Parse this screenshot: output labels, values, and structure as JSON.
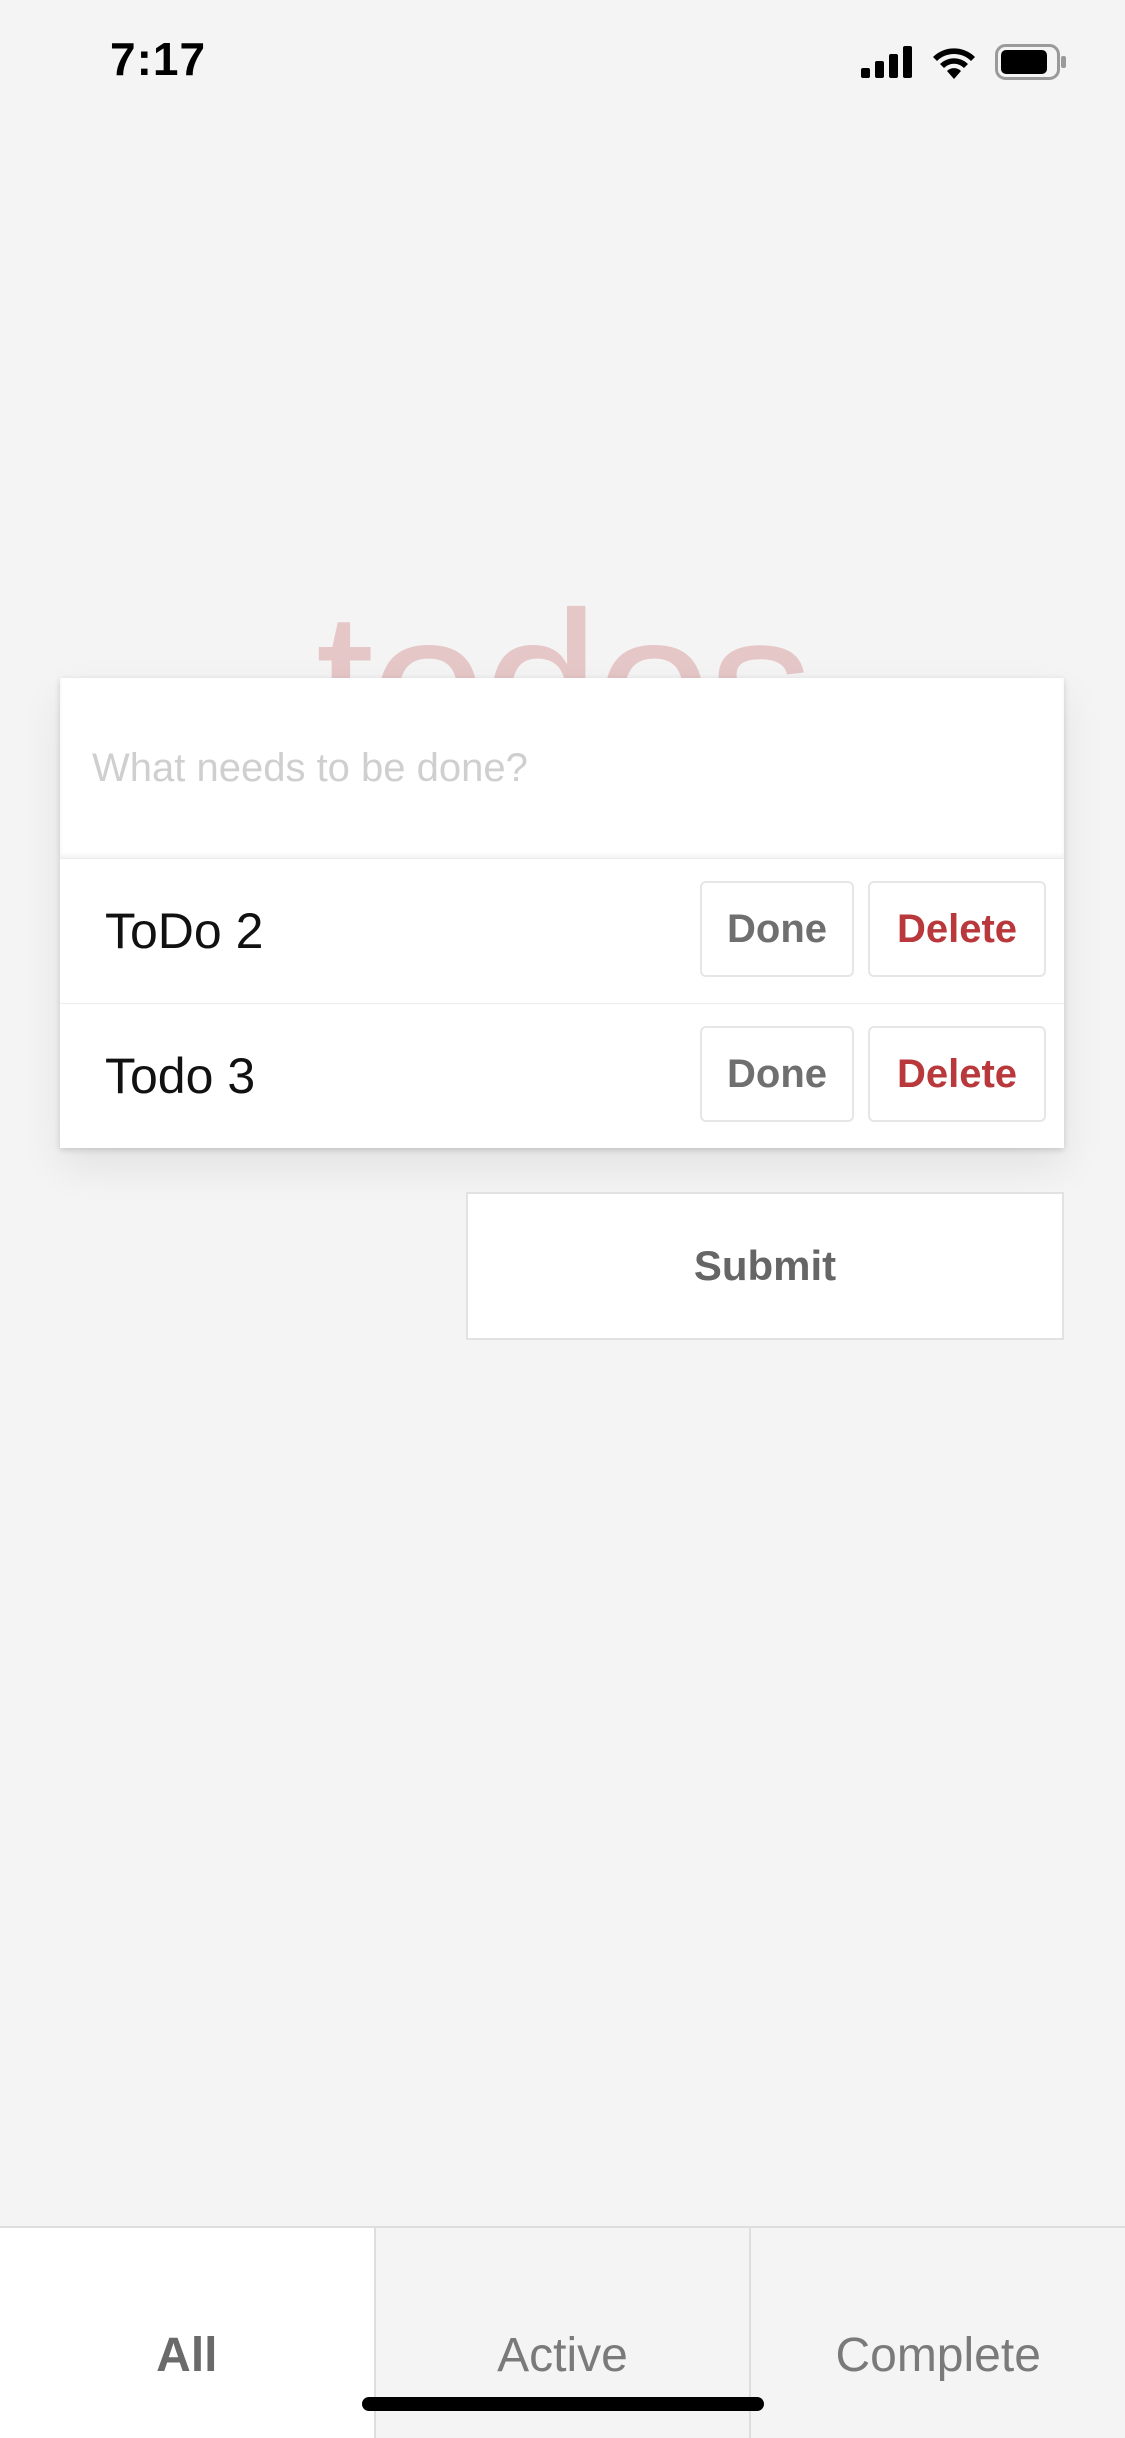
{
  "status_bar": {
    "time": "7:17",
    "icons": [
      "signal-icon",
      "wifi-icon",
      "battery-icon"
    ]
  },
  "app": {
    "title": "todos"
  },
  "new_todo": {
    "placeholder": "What needs to be done?",
    "value": ""
  },
  "todos": [
    {
      "label": "ToDo 2",
      "done_label": "Done",
      "delete_label": "Delete"
    },
    {
      "label": "Todo 3",
      "done_label": "Done",
      "delete_label": "Delete"
    }
  ],
  "submit": {
    "label": "Submit"
  },
  "filters": {
    "selected": "All",
    "tabs": [
      {
        "label": "All"
      },
      {
        "label": "Active"
      },
      {
        "label": "Complete"
      }
    ]
  },
  "colors": {
    "title": "#e6c7c7",
    "delete": "#b8383b",
    "background": "#f4f4f4"
  }
}
